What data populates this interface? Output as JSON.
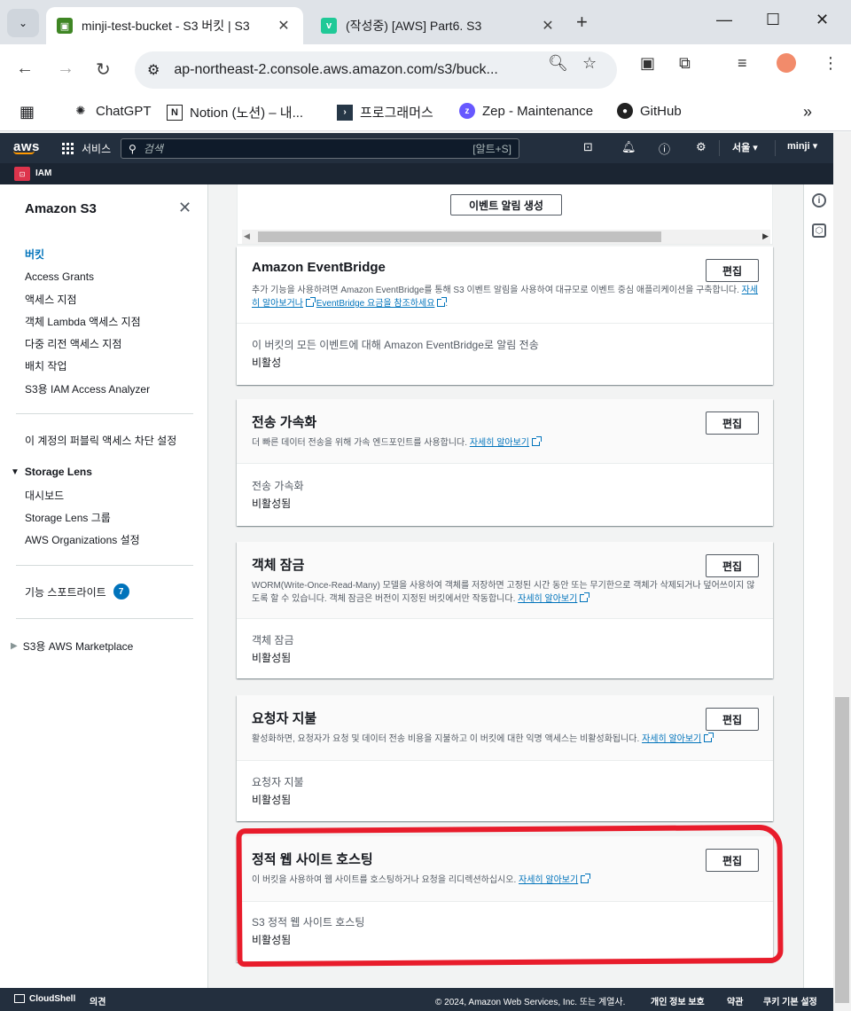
{
  "browser": {
    "tabs": [
      {
        "title": "minji-test-bucket - S3 버킷 | S3",
        "active": true
      },
      {
        "title": "(작성중) [AWS] Part6. S3",
        "active": false
      }
    ],
    "new_tab": "+",
    "url": "ap-northeast-2.console.aws.amazon.com/s3/buck...",
    "bookmarks": [
      "ChatGPT",
      "Notion (노션) – 내...",
      "프로그래머스",
      "Zep - Maintenance",
      "GitHub"
    ]
  },
  "aws_nav": {
    "logo": "aws",
    "services": "서비스",
    "search_placeholder": "검색",
    "search_shortcut": "[알트+S]",
    "region": "서울 ▾",
    "user": "minji ▾",
    "recent_service": "IAM"
  },
  "sidebar": {
    "title": "Amazon S3",
    "items": [
      "버킷",
      "Access Grants",
      "액세스 지점",
      "객체 Lambda 액세스 지점",
      "다중 리전 액세스 지점",
      "배치 작업",
      "S3용 IAM Access Analyzer"
    ],
    "public_block": "이 계정의 퍼블릭 액세스 차단 설정",
    "storage_lens": {
      "title": "Storage Lens",
      "items": [
        "대시보드",
        "Storage Lens 그룹",
        "AWS Organizations 설정"
      ]
    },
    "feature_spotlight": {
      "label": "기능 스포트라이트",
      "count": "7"
    },
    "marketplace": "S3용 AWS Marketplace"
  },
  "main": {
    "create_event_button": "이벤트 알림 생성",
    "cards": [
      {
        "title": "Amazon EventBridge",
        "desc_before": "추가 기능을 사용하려면 Amazon EventBridge를 통해 S3 이벤트 알림을 사용하여 대규모로 이벤트 중심 애플리케이션을 구축합니다.",
        "link1": "자세히 알아보거나",
        "link2": "EventBridge 요금을 참조하세요",
        "desc_after": ".",
        "label": "이 버킷의 모든 이벤트에 대해 Amazon EventBridge로 알림 전송",
        "value": "비활성",
        "edit": "편집"
      },
      {
        "title": "전송 가속화",
        "desc_before": "더 빠른 데이터 전송을 위해 가속 엔드포인트를 사용합니다.",
        "link1": "자세히 알아보기",
        "label": "전송 가속화",
        "value": "비활성됨",
        "edit": "편집"
      },
      {
        "title": "객체 잠금",
        "desc_before": "WORM(Write-Once-Read-Many) 모델을 사용하여 객체를 저장하면 고정된 시간 동안 또는 무기한으로 객체가 삭제되거나 덮어쓰이지 않도록 할 수 있습니다. 객체 잠금은 버전이 지정된 버킷에서만 작동합니다.",
        "link1": "자세히 알아보기",
        "label": "객체 잠금",
        "value": "비활성됨",
        "edit": "편집"
      },
      {
        "title": "요청자 지불",
        "desc_before": "활성화하면, 요청자가 요청 및 데이터 전송 비용을 지불하고 이 버킷에 대한 익명 액세스는 비활성화됩니다.",
        "link1": "자세히 알아보기",
        "label": "요청자 지불",
        "value": "비활성됨",
        "edit": "편집"
      },
      {
        "title": "정적 웹 사이트 호스팅",
        "desc_before": "이 버킷을 사용하여 웹 사이트를 호스팅하거나 요청을 리디렉션하십시오.",
        "link1": "자세히 알아보기",
        "label": "S3 정적 웹 사이트 호스팅",
        "value": "비활성됨",
        "edit": "편집"
      }
    ]
  },
  "footer": {
    "cloudshell": "CloudShell",
    "feedback": "의견",
    "copyright": "© 2024, Amazon Web Services, Inc. 또는 계열사.",
    "privacy": "개인 정보 보호",
    "terms": "약관",
    "cookies": "쿠키 기본 설정"
  },
  "colors": {
    "aws_nav": "#232f3e",
    "link": "#0073bb",
    "highlight": "#e81c2b",
    "s3_green": "#3f8624"
  }
}
